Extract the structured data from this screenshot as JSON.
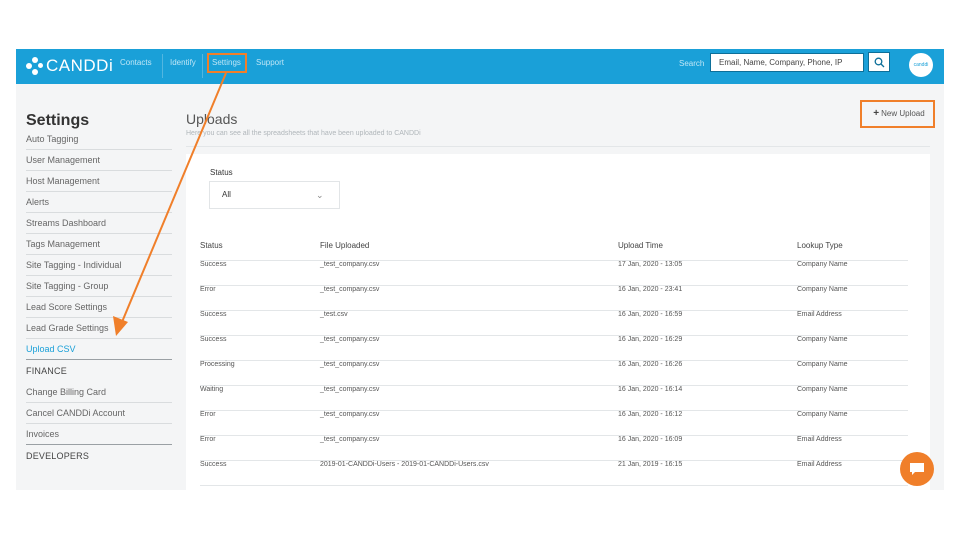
{
  "topbar": {
    "logo_text": "CANDDi",
    "nav": [
      {
        "label": "Contacts"
      },
      {
        "label": "Identify"
      },
      {
        "label": "Settings"
      },
      {
        "label": "Support"
      }
    ],
    "search_label": "Search",
    "search_placeholder": "Email, Name, Company, Phone, IP",
    "search_icon": "magnifier-icon",
    "avatar_label": "canddi"
  },
  "sidebar": {
    "title": "Settings",
    "settings_items": [
      {
        "label": "Auto Tagging"
      },
      {
        "label": "User Management"
      },
      {
        "label": "Host Management"
      },
      {
        "label": "Alerts"
      },
      {
        "label": "Streams Dashboard"
      },
      {
        "label": "Tags Management"
      },
      {
        "label": "Site Tagging - Individual"
      },
      {
        "label": "Site Tagging - Group"
      },
      {
        "label": "Lead Score Settings"
      },
      {
        "label": "Lead Grade Settings"
      },
      {
        "label": "Upload CSV"
      }
    ],
    "finance_heading": "FINANCE",
    "finance_items": [
      {
        "label": "Change Billing Card"
      },
      {
        "label": "Cancel CANDDi Account"
      },
      {
        "label": "Invoices"
      }
    ],
    "developers_heading": "DEVELOPERS"
  },
  "main": {
    "title": "Uploads",
    "subtitle": "Here you can see all the spreadsheets that have been uploaded to CANDDi",
    "new_upload_label": "New Upload",
    "status_filter_label": "Status",
    "status_filter_value": "All",
    "table": {
      "headers": [
        "Status",
        "File Uploaded",
        "Upload Time",
        "Lookup Type"
      ],
      "rows": [
        {
          "status": "Success",
          "file": "_test_company.csv",
          "time": "17 Jan, 2020 - 13:05",
          "lookup": "Company Name"
        },
        {
          "status": "Error",
          "file": "_test_company.csv",
          "time": "16 Jan, 2020 - 23:41",
          "lookup": "Company Name"
        },
        {
          "status": "Success",
          "file": "_test.csv",
          "time": "16 Jan, 2020 - 16:59",
          "lookup": "Email Address"
        },
        {
          "status": "Success",
          "file": "_test_company.csv",
          "time": "16 Jan, 2020 - 16:29",
          "lookup": "Company Name"
        },
        {
          "status": "Processing",
          "file": "_test_company.csv",
          "time": "16 Jan, 2020 - 16:26",
          "lookup": "Company Name"
        },
        {
          "status": "Waiting",
          "file": "_test_company.csv",
          "time": "16 Jan, 2020 - 16:14",
          "lookup": "Company Name"
        },
        {
          "status": "Error",
          "file": "_test_company.csv",
          "time": "16 Jan, 2020 - 16:12",
          "lookup": "Company Name"
        },
        {
          "status": "Error",
          "file": "_test_company.csv",
          "time": "16 Jan, 2020 - 16:09",
          "lookup": "Email Address"
        },
        {
          "status": "Success",
          "file": "2019-01-CANDDi-Users - 2019-01-CANDDi-Users.csv",
          "time": "21 Jan, 2019 - 16:15",
          "lookup": "Email Address"
        }
      ]
    }
  },
  "colors": {
    "brand_blue": "#1aa0d8",
    "highlight_orange": "#f07f2a",
    "success": "#5fbf5a",
    "error": "#e05a5a",
    "processing": "#3fb8d9"
  },
  "chat_icon": "chat-bubble-icon"
}
